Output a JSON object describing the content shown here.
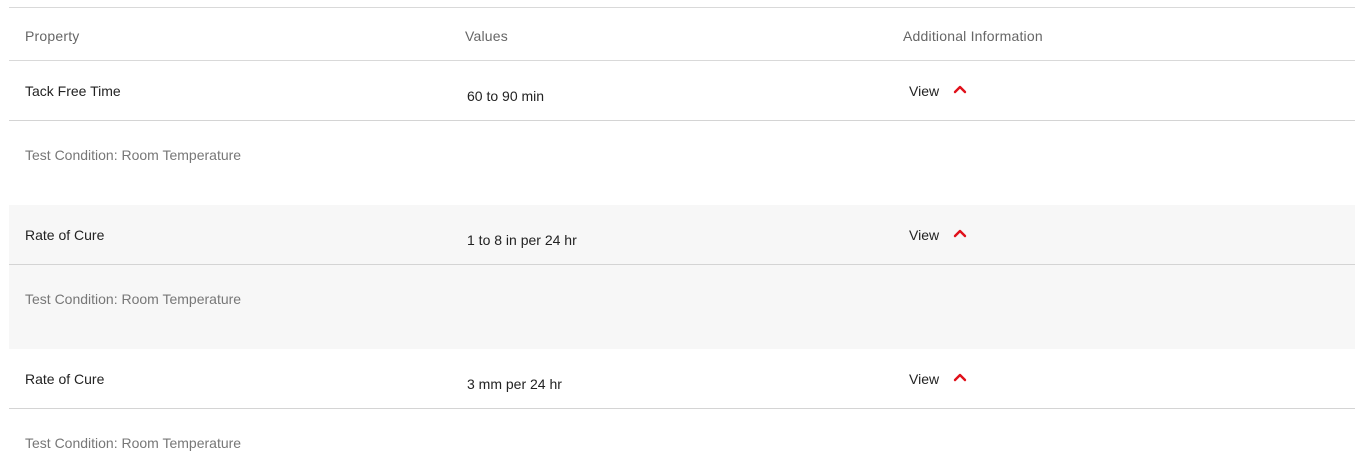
{
  "header": {
    "property": "Property",
    "values": "Values",
    "additional_information": "Additional Information"
  },
  "rows": [
    {
      "property": "Tack Free Time",
      "value": "60 to 90 min",
      "view_label": "View",
      "test_condition": "Test Condition: Room Temperature"
    },
    {
      "property": "Rate of Cure",
      "value": "1 to 8 in per 24 hr",
      "view_label": "View",
      "test_condition": "Test Condition: Room Temperature"
    },
    {
      "property": "Rate of Cure",
      "value": "3 mm per 24 hr",
      "view_label": "View",
      "test_condition": "Test Condition: Room Temperature"
    }
  ],
  "icons": {
    "expand": "chevron-up-icon"
  },
  "colors": {
    "accent": "#e0101a",
    "shaded_row": "#f7f7f7",
    "divider": "#d4d4d4",
    "muted_text": "#777777"
  }
}
